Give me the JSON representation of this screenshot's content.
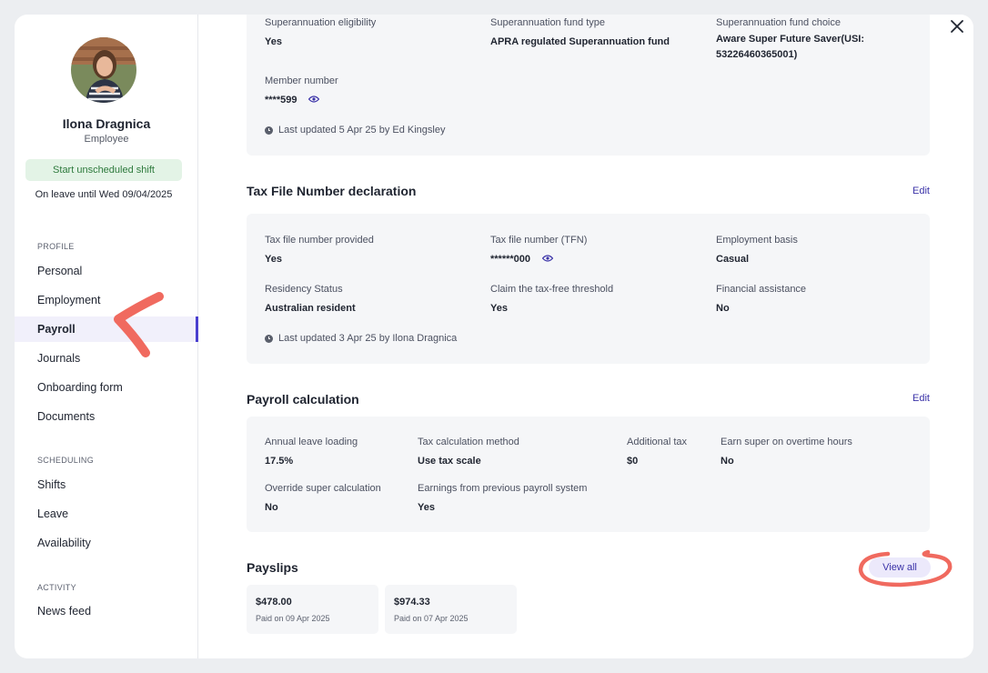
{
  "employee": {
    "name": "Ilona Dragnica",
    "role": "Employee",
    "shift_button": "Start unscheduled shift",
    "leave_status": "On leave until Wed 09/04/2025"
  },
  "sidebar": {
    "profile_label": "PROFILE",
    "profile_items": [
      "Personal",
      "Employment",
      "Payroll",
      "Journals",
      "Onboarding form",
      "Documents"
    ],
    "scheduling_label": "SCHEDULING",
    "scheduling_items": [
      "Shifts",
      "Leave",
      "Availability"
    ],
    "activity_label": "ACTIVITY",
    "activity_items": [
      "News feed"
    ],
    "active_item": "Payroll"
  },
  "superannuation": {
    "eligibility_label": "Superannuation eligibility",
    "eligibility_value": "Yes",
    "fund_type_label": "Superannuation fund type",
    "fund_type_value": "APRA regulated Superannuation fund",
    "fund_choice_label": "Superannuation fund choice",
    "fund_choice_value_1": "Aware Super Future Saver(USI:",
    "fund_choice_value_2": "53226460365001)",
    "member_label": "Member number",
    "member_value": "****599",
    "updated": "Last updated 5 Apr 25 by Ed Kingsley"
  },
  "tfn": {
    "title": "Tax File Number declaration",
    "edit": "Edit",
    "provided_label": "Tax file number provided",
    "provided_value": "Yes",
    "tfn_label": "Tax file number (TFN)",
    "tfn_value": "******000",
    "basis_label": "Employment basis",
    "basis_value": "Casual",
    "residency_label": "Residency Status",
    "residency_value": "Australian resident",
    "threshold_label": "Claim the tax-free threshold",
    "threshold_value": "Yes",
    "assistance_label": "Financial assistance",
    "assistance_value": "No",
    "updated": "Last updated 3 Apr 25 by Ilona Dragnica"
  },
  "payroll_calc": {
    "title": "Payroll calculation",
    "edit": "Edit",
    "leave_loading_label": "Annual leave loading",
    "leave_loading_value": "17.5%",
    "tax_method_label": "Tax calculation method",
    "tax_method_value": "Use tax scale",
    "additional_tax_label": "Additional tax",
    "additional_tax_value": "$0",
    "overtime_super_label": "Earn super on overtime hours",
    "overtime_super_value": "No",
    "override_label": "Override super calculation",
    "override_value": "No",
    "previous_label": "Earnings from previous payroll system",
    "previous_value": "Yes"
  },
  "payslips": {
    "title": "Payslips",
    "view_all": "View all",
    "items": [
      {
        "amount": "$478.00",
        "paid": "Paid on 09 Apr 2025"
      },
      {
        "amount": "$974.33",
        "paid": "Paid on 07 Apr 2025"
      }
    ]
  },
  "colors": {
    "accent": "#4a3fcf",
    "link": "#3b33a8",
    "success_bg": "#e3f3e6",
    "success_text": "#2e7a3d",
    "annotation": "#f06a5f"
  }
}
